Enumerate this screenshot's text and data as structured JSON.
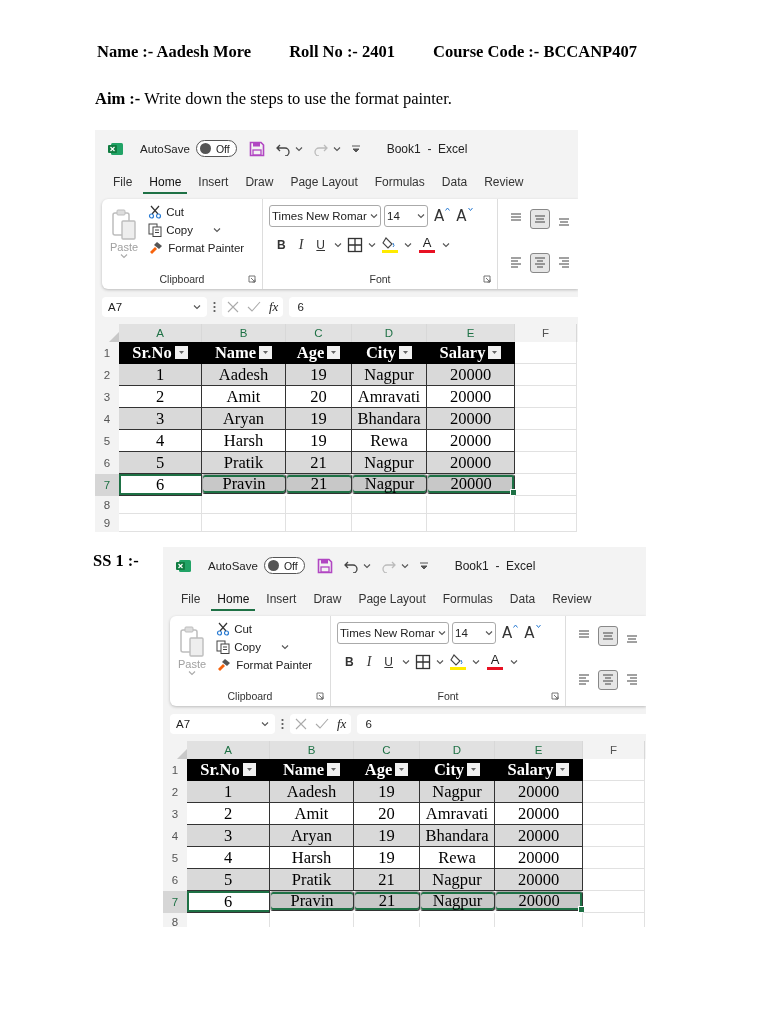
{
  "header": {
    "name": "Name :- Aadesh More",
    "roll_no": "Roll No :- 2401",
    "course_code": "Course Code :- BCCANP407"
  },
  "aim": "**Aim :-** Write down the steps to use the format painter.",
  "shots": [
    {
      "autosave": "AutoSave",
      "toggle": {
        "label": "Off",
        "on": false
      },
      "title": "Book1  -  Excel",
      "tabs": [
        {
          "label": "File",
          "selected": false
        },
        {
          "label": "Home",
          "selected": true
        },
        {
          "label": "Insert",
          "selected": false
        },
        {
          "label": "Draw",
          "selected": false
        },
        {
          "label": "Page Layout",
          "selected": false
        },
        {
          "label": "Formulas",
          "selected": false
        },
        {
          "label": "Data",
          "selected": false
        },
        {
          "label": "Review",
          "selected": false
        }
      ],
      "paste": {
        "label": "Paste",
        "disabled": true
      },
      "cut": "Cut",
      "copy": "Copy",
      "format_painter": "Format Painter",
      "clipboard_label": "Clipboard",
      "font_name": "Times New Romar",
      "font_size": "14",
      "grow_font": "A",
      "shrink_font": "A",
      "bold": "B",
      "italic": "I",
      "underline": "U",
      "font_color": "A",
      "font_label": "Font",
      "alignment_buttons": [
        {
          "pressed": false
        },
        {
          "pressed": true
        },
        {
          "pressed": false
        },
        {
          "pressed": false
        },
        {
          "pressed": true
        },
        {
          "pressed": false
        }
      ],
      "name_box": "A7",
      "fx": "fx",
      "formula": "6",
      "columns": [
        "A",
        "B",
        "C",
        "D",
        "E",
        "F"
      ],
      "rows": [
        {
          "number": "1",
          "kind": "header",
          "cells": [
            "Sr.No",
            "Name",
            "Age",
            "City",
            "Salary"
          ]
        },
        {
          "number": "2",
          "kind": "data",
          "shaded": true,
          "selected": false,
          "cells": [
            "1",
            "Aadesh",
            "19",
            "Nagpur",
            "20000"
          ]
        },
        {
          "number": "3",
          "kind": "data",
          "shaded": false,
          "selected": false,
          "cells": [
            "2",
            "Amit",
            "20",
            "Amravati",
            "20000"
          ]
        },
        {
          "number": "4",
          "kind": "data",
          "shaded": true,
          "selected": false,
          "cells": [
            "3",
            "Aryan",
            "19",
            "Bhandara",
            "20000"
          ]
        },
        {
          "number": "5",
          "kind": "data",
          "shaded": false,
          "selected": false,
          "cells": [
            "4",
            "Harsh",
            "19",
            "Rewa",
            "20000"
          ]
        },
        {
          "number": "6",
          "kind": "data",
          "shaded": true,
          "selected": false,
          "cells": [
            "5",
            "Pratik",
            "21",
            "Nagpur",
            "20000"
          ]
        },
        {
          "number": "7",
          "kind": "data",
          "shaded": false,
          "selected": true,
          "cells": [
            "6",
            "Pravin",
            "21",
            "Nagpur",
            "20000"
          ]
        },
        {
          "number": "8",
          "kind": "empty"
        },
        {
          "number": "9",
          "kind": "empty"
        }
      ]
    },
    {
      "caption": "SS 1 :-",
      "autosave": "AutoSave",
      "toggle": {
        "label": "Off",
        "on": false
      },
      "title": "Book1  -  Excel",
      "tabs": [
        {
          "label": "File",
          "selected": false
        },
        {
          "label": "Home",
          "selected": true
        },
        {
          "label": "Insert",
          "selected": false
        },
        {
          "label": "Draw",
          "selected": false
        },
        {
          "label": "Page Layout",
          "selected": false
        },
        {
          "label": "Formulas",
          "selected": false
        },
        {
          "label": "Data",
          "selected": false
        },
        {
          "label": "Review",
          "selected": false
        }
      ],
      "paste": {
        "label": "Paste",
        "disabled": true
      },
      "cut": "Cut",
      "copy": "Copy",
      "format_painter": "Format Painter",
      "clipboard_label": "Clipboard",
      "font_name": "Times New Romar",
      "font_size": "14",
      "grow_font": "A",
      "shrink_font": "A",
      "bold": "B",
      "italic": "I",
      "underline": "U",
      "font_color": "A",
      "font_label": "Font",
      "alignment_buttons": [
        {
          "pressed": false
        },
        {
          "pressed": true
        },
        {
          "pressed": false
        },
        {
          "pressed": false
        },
        {
          "pressed": true
        },
        {
          "pressed": false
        }
      ],
      "name_box": "A7",
      "fx": "fx",
      "formula": "6",
      "columns": [
        "A",
        "B",
        "C",
        "D",
        "E",
        "F"
      ],
      "rows": [
        {
          "number": "1",
          "kind": "header",
          "cells": [
            "Sr.No",
            "Name",
            "Age",
            "City",
            "Salary"
          ]
        },
        {
          "number": "2",
          "kind": "data",
          "shaded": true,
          "selected": false,
          "cells": [
            "1",
            "Aadesh",
            "19",
            "Nagpur",
            "20000"
          ]
        },
        {
          "number": "3",
          "kind": "data",
          "shaded": false,
          "selected": false,
          "cells": [
            "2",
            "Amit",
            "20",
            "Amravati",
            "20000"
          ]
        },
        {
          "number": "4",
          "kind": "data",
          "shaded": true,
          "selected": false,
          "cells": [
            "3",
            "Aryan",
            "19",
            "Bhandara",
            "20000"
          ]
        },
        {
          "number": "5",
          "kind": "data",
          "shaded": false,
          "selected": false,
          "cells": [
            "4",
            "Harsh",
            "19",
            "Rewa",
            "20000"
          ]
        },
        {
          "number": "6",
          "kind": "data",
          "shaded": true,
          "selected": false,
          "cells": [
            "5",
            "Pratik",
            "21",
            "Nagpur",
            "20000"
          ]
        },
        {
          "number": "7",
          "kind": "data",
          "shaded": false,
          "selected": true,
          "cells": [
            "6",
            "Pravin",
            "21",
            "Nagpur",
            "20000"
          ]
        },
        {
          "number": "8",
          "kind": "empty"
        }
      ]
    }
  ]
}
